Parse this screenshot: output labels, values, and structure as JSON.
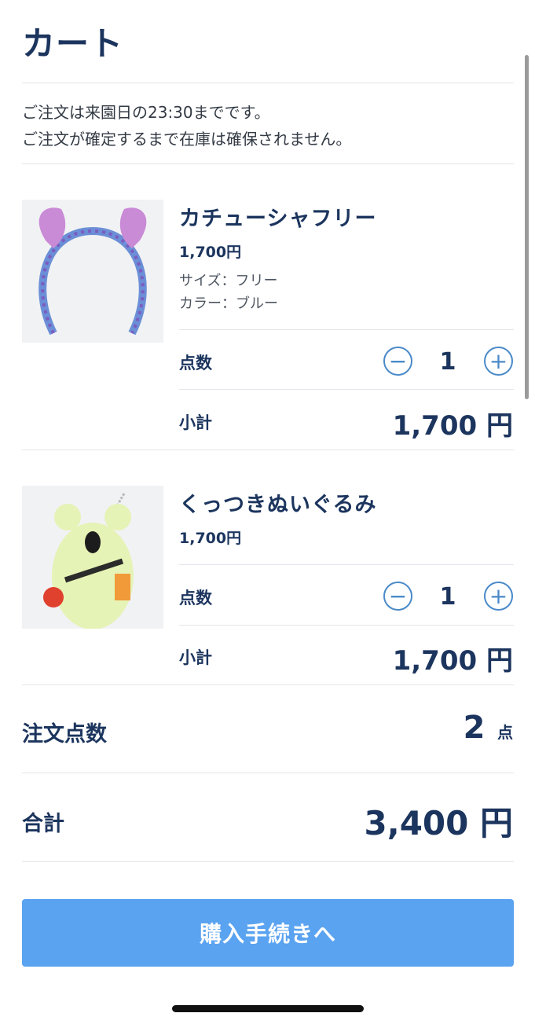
{
  "header": {
    "title": "カート"
  },
  "notice": {
    "line1": "ご注文は来園日の23:30までです。",
    "line2": "ご注文が確定するまで在庫は確保されません。"
  },
  "items": [
    {
      "name": "カチューシャフリー",
      "price": "1,700円",
      "size": "サイズ：フリー",
      "color": "カラー：ブルー",
      "qty_label": "点数",
      "qty": "1",
      "subtotal_label": "小計",
      "subtotal": "1,700 円"
    },
    {
      "name": "くっつきぬいぐるみ",
      "price": "1,700円",
      "qty_label": "点数",
      "qty": "1",
      "subtotal_label": "小計",
      "subtotal": "1,700 円"
    }
  ],
  "summary": {
    "count_label": "注文点数",
    "count_value": "2",
    "count_unit": "点",
    "total_label": "合計",
    "total_value": "3,400 円"
  },
  "cta": {
    "label": "購入手続きへ"
  },
  "colors": {
    "navy": "#1c355e",
    "accent": "#4a8ac9",
    "button": "#5aa3f0"
  },
  "icons": {
    "minus": "minus-circle-icon",
    "plus": "plus-circle-icon"
  }
}
